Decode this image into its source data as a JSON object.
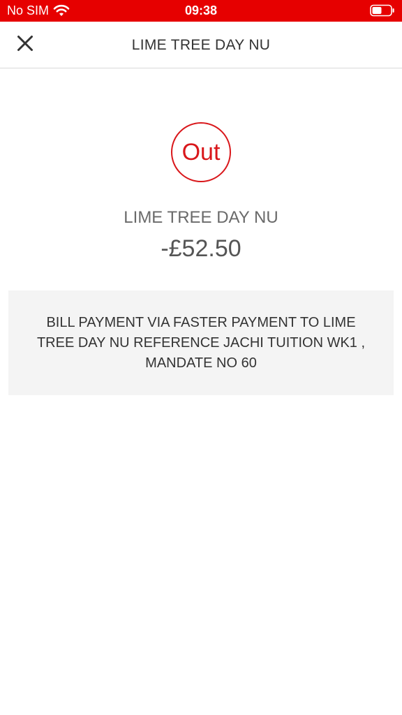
{
  "status_bar": {
    "carrier": "No SIM",
    "time": "09:38",
    "wifi_icon": "wifi-icon",
    "battery_icon": "battery-icon",
    "background_color": "#e60000"
  },
  "header": {
    "title": "LIME TREE DAY NU",
    "close_icon": "close-icon"
  },
  "transaction": {
    "direction_label": "Out",
    "payee": "LIME TREE DAY NU",
    "amount": "-£52.50",
    "description": "BILL PAYMENT VIA FASTER PAYMENT TO LIME TREE DAY NU REFERENCE JACHI TUITION WK1 , MANDATE NO 60",
    "accent_color": "#d9171b"
  }
}
